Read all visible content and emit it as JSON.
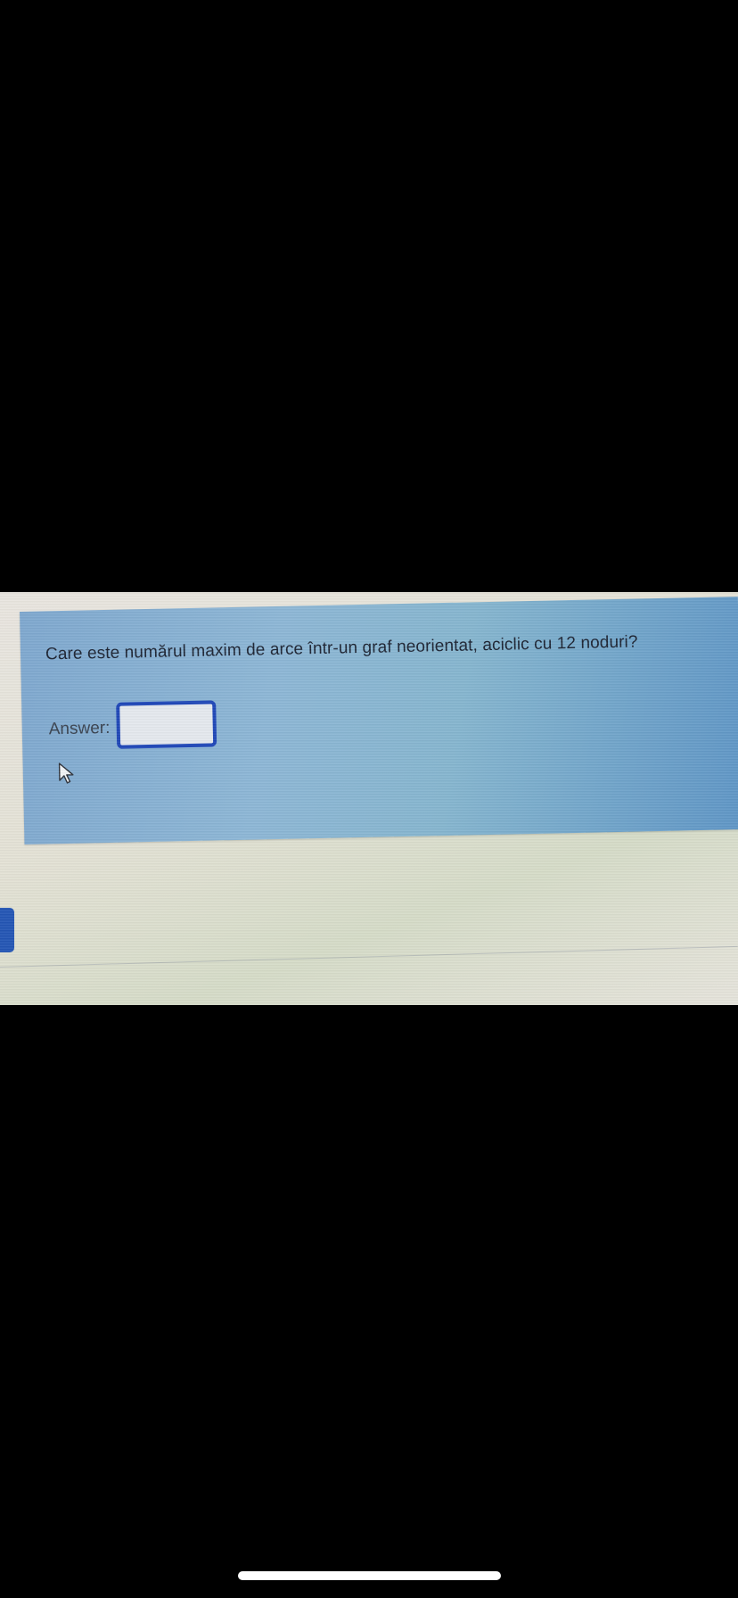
{
  "question": {
    "text": "Care este numărul maxim de arce într-un graf neorientat, aciclic cu 12 noduri?",
    "answer_label": "Answer:",
    "answer_value": "",
    "answer_placeholder": ""
  },
  "colors": {
    "panel": "#8db7d6",
    "input_border": "#1f47b8",
    "side_tab": "#2456b5"
  },
  "icons": {
    "cursor": "mouse-pointer-icon"
  }
}
